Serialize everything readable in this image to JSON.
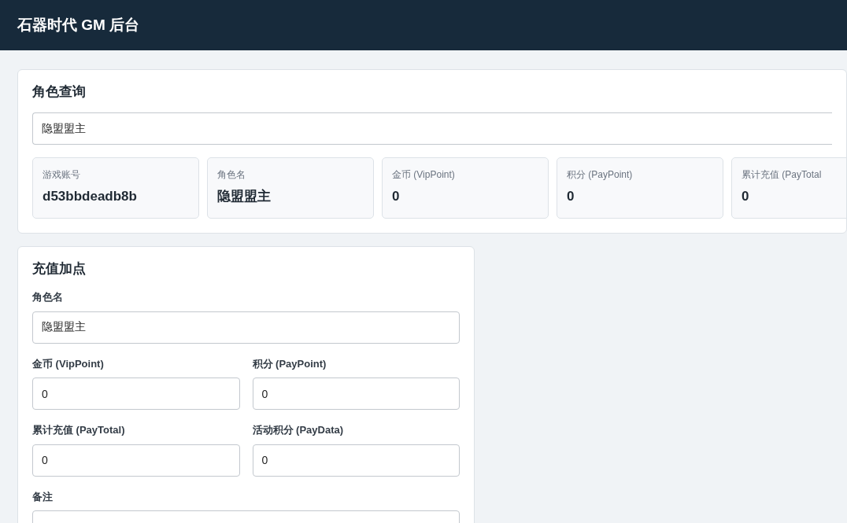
{
  "header": {
    "title": "石器时代 GM 后台"
  },
  "query": {
    "title": "角色查询",
    "search": {
      "value": "隐盟盟主"
    },
    "stats": [
      {
        "label": "游戏账号",
        "value": "d53bbdeadb8b"
      },
      {
        "label": "角色名",
        "value": "隐盟盟主"
      },
      {
        "label": "金币 (VipPoint)",
        "value": "0"
      },
      {
        "label": "积分 (PayPoint)",
        "value": "0"
      },
      {
        "label": "累计充值 (PayTotal",
        "value": "0"
      }
    ]
  },
  "recharge": {
    "title": "充值加点",
    "fields": [
      {
        "kind": "full",
        "label": "角色名",
        "value": "隐盟盟主"
      },
      {
        "kind": "half",
        "label": "金币 (VipPoint)",
        "value": "0"
      },
      {
        "kind": "half",
        "label": "积分 (PayPoint)",
        "value": "0"
      },
      {
        "kind": "half",
        "label": "累计充值 (PayTotal)",
        "value": "0"
      },
      {
        "kind": "half",
        "label": "活动积分 (PayData)",
        "value": "0"
      },
      {
        "kind": "full",
        "label": "备注"
      }
    ]
  }
}
